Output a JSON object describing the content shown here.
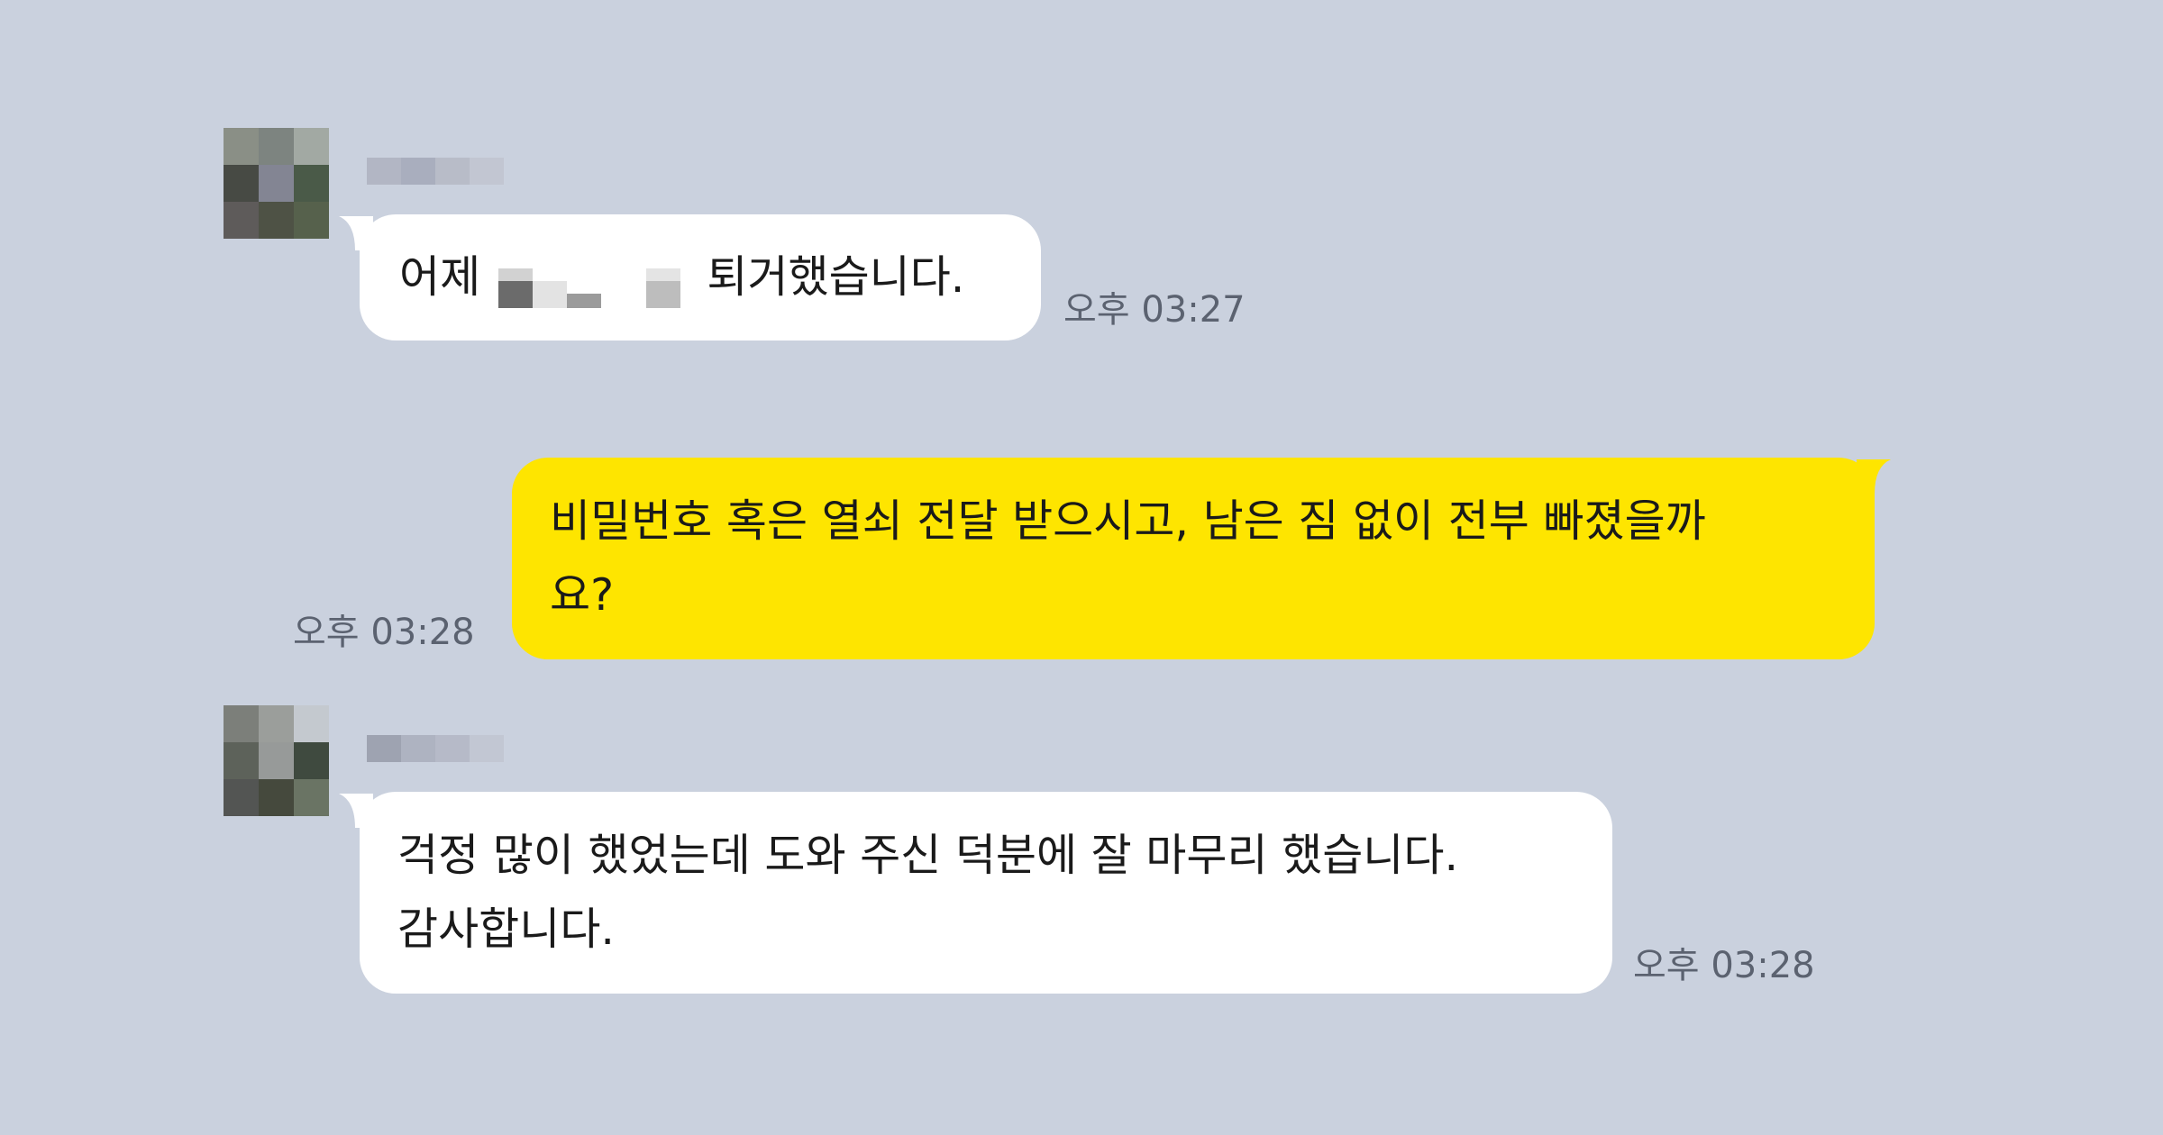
{
  "chat": {
    "messages": [
      {
        "sender": "other",
        "text_before": "어제",
        "text_after": "퇴거했습니다.",
        "time": "오후 03:27"
      },
      {
        "sender": "me",
        "line1": "비밀번호 혹은 열쇠 전달 받으시고, 남은 짐 없이 전부 빠졌을까",
        "line2": "요?",
        "time": "오후 03:28"
      },
      {
        "sender": "other",
        "line1": "걱정 많이 했었는데 도와 주신 덕분에 잘 마무리 했습니다.",
        "line2": "감사합니다.",
        "time": "오후 03:28"
      }
    ]
  },
  "colors": {
    "background": "#cad1de",
    "incoming_bubble": "#ffffff",
    "outgoing_bubble": "#fee500",
    "timestamp": "#5b6270"
  },
  "icons": {
    "avatar": "pixelated-profile-avatar",
    "name": "pixelated-sender-name"
  }
}
